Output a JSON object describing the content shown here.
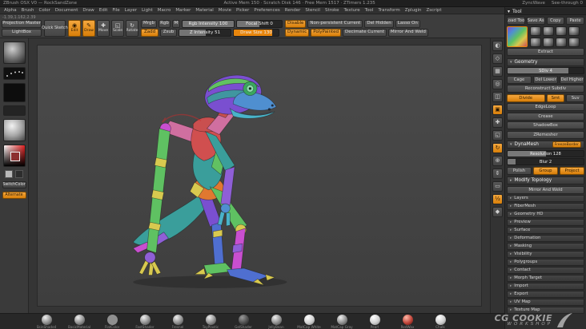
{
  "colors": {
    "accent": "#e8860d",
    "accent_bright": "#f2a33c",
    "ui_bg": "#3d3d3d",
    "panel_bg": "#2e2e2e",
    "canvas_bg": "#434343"
  },
  "title_bar": {
    "app": "ZBrush OSX V0 — RockSandZone",
    "stats": "Active Mem 150 · Scratch Disk 146 · Free Mem 1517 · ZTimers 1.235",
    "user": "ZyncWave",
    "view_mode": "See-through 0"
  },
  "menu": {
    "items": [
      "Alpha",
      "Brush",
      "Color",
      "Document",
      "Draw",
      "Edit",
      "File",
      "Layer",
      "Light",
      "Macro",
      "Marker",
      "Material",
      "Movie",
      "Picker",
      "Preferences",
      "Render",
      "Stencil",
      "Stroke",
      "Texture",
      "Tool",
      "Transform",
      "Zplugin",
      "Zscript"
    ]
  },
  "toolbar": {
    "coord_readout": "-1.39,1.162,2.39",
    "projection_master": "Projection Master",
    "lightbox": "LightBox",
    "quick_sketch": "Quick Sketch",
    "modes": [
      {
        "name": "edit-mode-button",
        "label": "Edit",
        "glyph": "◉",
        "state": "active"
      },
      {
        "name": "draw-mode-button",
        "label": "Draw",
        "glyph": "✎",
        "state": "active"
      },
      {
        "name": "move-mode-button",
        "label": "Move",
        "glyph": "✚",
        "state": "normal"
      },
      {
        "name": "scale-mode-button",
        "label": "Scale",
        "glyph": "◱",
        "state": "normal"
      },
      {
        "name": "rotate-mode-button",
        "label": "Rotate",
        "glyph": "↻",
        "state": "normal"
      }
    ],
    "mrgb": {
      "label": "Mrgb",
      "state": "normal"
    },
    "rgb": {
      "label": "Rgb",
      "state": "normal"
    },
    "m": {
      "label": "M",
      "state": "normal"
    },
    "zadd": {
      "label": "Zadd",
      "state": "active"
    },
    "zsub": {
      "label": "Zsub",
      "state": "normal"
    },
    "rgb_intensity": {
      "label": "Rgb Intensity 100",
      "fill": 100,
      "state": "normal"
    },
    "z_intensity": {
      "label": "Z Intensity 51",
      "fill": 51,
      "state": "normal"
    },
    "focal_shift": {
      "label": "Focal Shift 0",
      "fill": 50,
      "state": "normal"
    },
    "draw_size": {
      "label": "Draw Size 130",
      "fill": 85,
      "state": "active"
    },
    "toggles_row1": [
      {
        "label": "Disable",
        "state": "active"
      },
      {
        "label": "Non-persistent Current",
        "state": "normal"
      },
      {
        "label": "Del Hidden",
        "state": "normal"
      },
      {
        "label": "Lasso On",
        "state": "normal"
      }
    ],
    "toggles_row2": [
      {
        "label": "Dynamic",
        "state": "active"
      },
      {
        "label": "PolyPainted",
        "state": "active"
      },
      {
        "label": "Decimate Current",
        "state": "normal"
      },
      {
        "label": "Mirror And Weld",
        "state": "normal"
      }
    ]
  },
  "left_shelf": {
    "switch_color": "SwitchColor",
    "alternate": "Alternate"
  },
  "right_shelf": {
    "icons": [
      {
        "name": "bpr-icon",
        "glyph": "◐",
        "state": "normal"
      },
      {
        "name": "persp-icon",
        "glyph": "◇",
        "state": "normal"
      },
      {
        "name": "floor-icon",
        "glyph": "▦",
        "state": "normal"
      },
      {
        "name": "local-icon",
        "glyph": "◎",
        "state": "normal"
      },
      {
        "name": "lsym-icon",
        "glyph": "◫",
        "state": "normal"
      },
      {
        "name": "frame-icon",
        "glyph": "▣",
        "state": "active"
      },
      {
        "name": "move-icon",
        "glyph": "✚",
        "state": "normal"
      },
      {
        "name": "scale-icon",
        "glyph": "◱",
        "state": "normal"
      },
      {
        "name": "rotate-icon",
        "glyph": "↻",
        "state": "active"
      },
      {
        "name": "zoom-icon",
        "glyph": "⊕",
        "state": "normal"
      },
      {
        "name": "scroll-icon",
        "glyph": "⇕",
        "state": "normal"
      },
      {
        "name": "actual-size-icon",
        "glyph": "▭",
        "state": "normal"
      },
      {
        "name": "aa-half-icon",
        "glyph": "½",
        "state": "active"
      },
      {
        "name": "xyz-icon",
        "glyph": "◆",
        "state": "normal"
      }
    ]
  },
  "tool_panel": {
    "title": "Tool",
    "header_buttons": [
      "Load Tool",
      "Save As",
      "Copy",
      "Paste"
    ],
    "extract": "Extract",
    "geometry_header": "Geometry",
    "sdiv": {
      "label": "SDiv 4",
      "fill": 80,
      "state": "normal"
    },
    "cage": "Cage",
    "del_lower": "Del Lower",
    "del_higher": "Del Higher",
    "reconstruct": "Reconstruct Subdiv",
    "divide": {
      "label": "Divide",
      "state": "active"
    },
    "smt": {
      "label": "Smt",
      "state": "active"
    },
    "suv": {
      "label": "Suv",
      "state": "normal"
    },
    "mid_buttons": [
      "EdgeLoop",
      "Crease",
      "ShadowBox",
      "ZRemesher"
    ],
    "dynamesh_header": "DynaMesh",
    "freeze_border": {
      "label": "FreezeBorder",
      "state": "active"
    },
    "resolution": {
      "label": "Resolution 128",
      "fill": 50,
      "state": "normal"
    },
    "blur": {
      "label": "Blur 2",
      "fill": 10,
      "state": "normal"
    },
    "dynamesh_toggles": [
      {
        "label": "Polish",
        "state": "normal"
      },
      {
        "label": "Group",
        "state": "active"
      },
      {
        "label": "Project",
        "state": "active"
      }
    ],
    "modify_topology": "Modify Topology",
    "mirror_and_weld": "Mirror And Weld",
    "collapsed_sections": [
      "Layers",
      "FiberMesh",
      "Geometry HD",
      "Preview",
      "Surface",
      "Deformation",
      "Masking",
      "Visibility",
      "Polygroups",
      "Contact",
      "Morph Target",
      "Import",
      "Export",
      "UV Map",
      "Texture Map"
    ]
  },
  "bottom_tray": {
    "materials": [
      {
        "label": "SkinShade4",
        "tint": "gray"
      },
      {
        "label": "BasicMaterial",
        "tint": "gray"
      },
      {
        "label": "FlatColor",
        "tint": "flat"
      },
      {
        "label": "FastShader",
        "tint": "gray"
      },
      {
        "label": "Fresnel",
        "tint": "gray"
      },
      {
        "label": "ToyPlastic",
        "tint": "gray"
      },
      {
        "label": "GelShader",
        "tint": "dark"
      },
      {
        "label": "JellyBean",
        "tint": "gray"
      },
      {
        "label": "MatCap White",
        "tint": "light"
      },
      {
        "label": "MatCap Gray",
        "tint": "gray"
      },
      {
        "label": "Pearl",
        "tint": "light"
      },
      {
        "label": "RedWax",
        "tint": "red"
      },
      {
        "label": "Chalk",
        "tint": "light"
      }
    ]
  },
  "watermark": {
    "line1": "CG COOKIE",
    "line2": "WORKSHOP"
  }
}
